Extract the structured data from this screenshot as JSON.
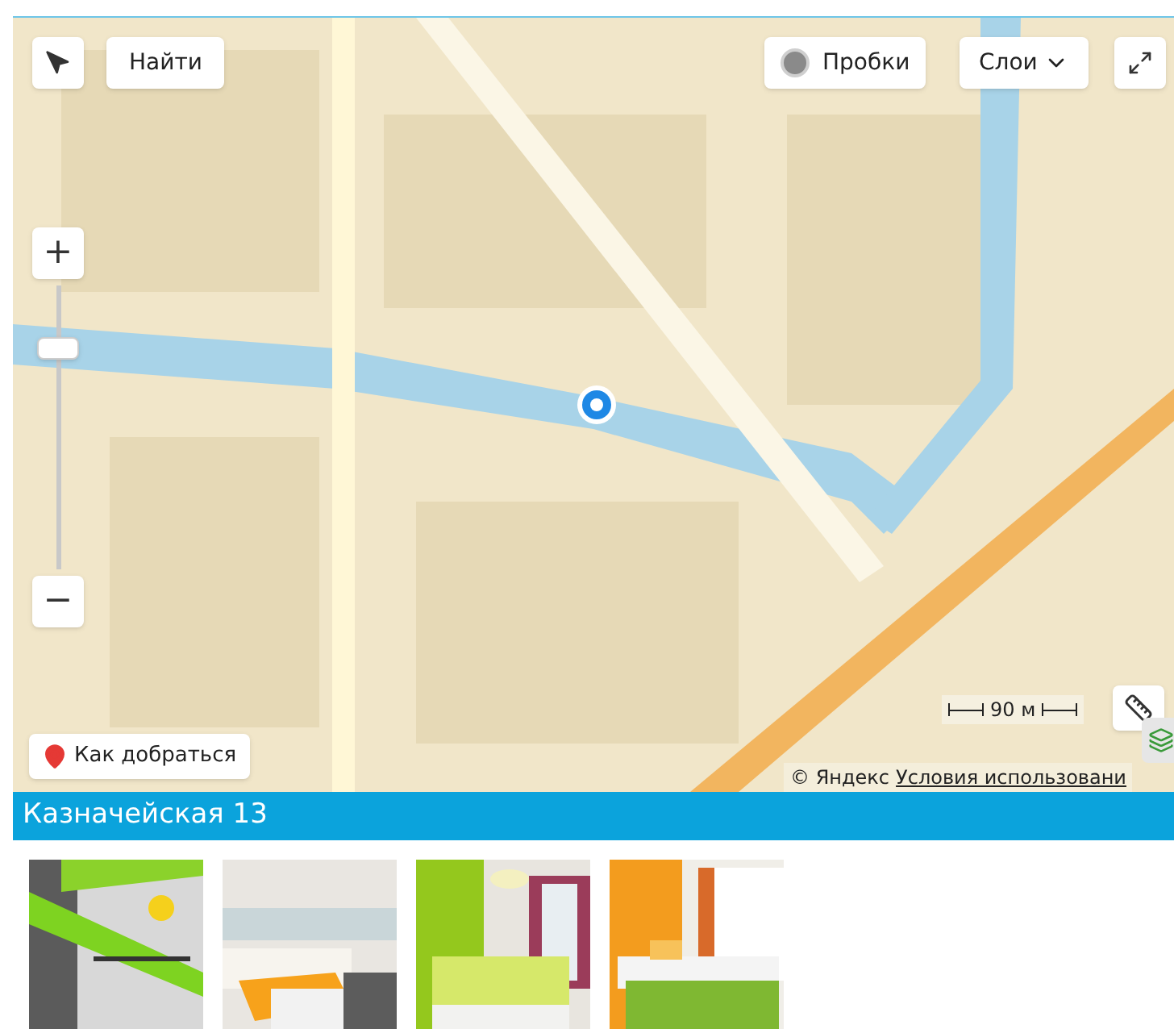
{
  "map": {
    "kind": "picture",
    "find_button": "Найти",
    "traffic_button": "Пробки",
    "layers_button": "Слои",
    "zoom_in": "+",
    "zoom_out": "−",
    "zoom": {
      "level": 0.8
    },
    "route_button": "Как добраться",
    "scale": "90 м",
    "copyright": "© Яндекс",
    "terms_link": "Условия использовани"
  },
  "address_bar": {
    "title": "Казначейская 13"
  }
}
